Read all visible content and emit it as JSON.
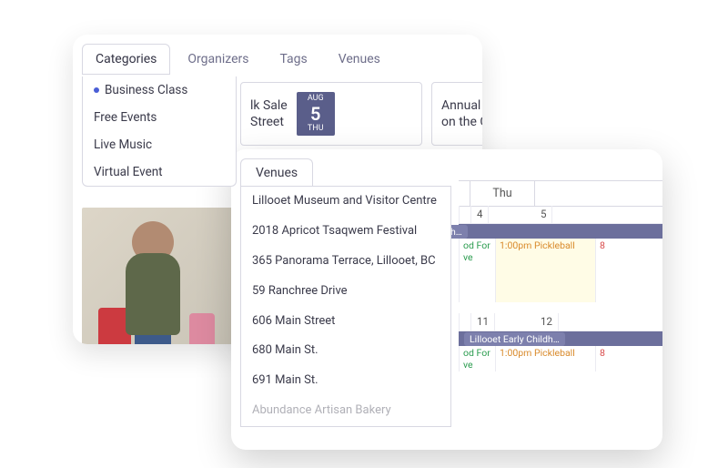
{
  "filter_tabs": {
    "categories": "Categories",
    "organizers": "Organizers",
    "tags": "Tags",
    "venues": "Venues"
  },
  "category_items": [
    "Business Class",
    "Free Events",
    "Live Music",
    "Virtual Event"
  ],
  "event_cards": [
    {
      "title_l1": "lk Sale",
      "title_l2": "Street",
      "badge_month": "AUG",
      "badge_day": "5",
      "badge_dow": "THU"
    },
    {
      "title_l1": "Annual Sidewalk S",
      "title_l2": "on the Church Str"
    }
  ],
  "venues_tab_label": "Venues",
  "venue_items": [
    "Lillooet Museum and Visitor Centre",
    "2018 Apricot Tsaqwem Festival",
    "365 Panorama Terrace, Lillooet, BC",
    "59 Ranchree Drive",
    "606 Main Street",
    "680 Main St.",
    "691 Main St.",
    "Abundance Artisan Bakery"
  ],
  "calendar": {
    "thu_header": "Thu",
    "dates_row1": {
      "wed": "4",
      "thu": "5"
    },
    "band1": "ildh…",
    "row1_events": {
      "wed_a": "od For",
      "wed_b": "ve",
      "thu": "1:00pm Pickleball",
      "fri": "8"
    },
    "dates_row2": {
      "wed": "11",
      "thu": "12"
    },
    "band2": "Lillooet Early Childh…",
    "row2_events": {
      "wed_a": "od For",
      "wed_b": "ve",
      "thu": "1:00pm Pickleball",
      "fri": "8"
    }
  }
}
